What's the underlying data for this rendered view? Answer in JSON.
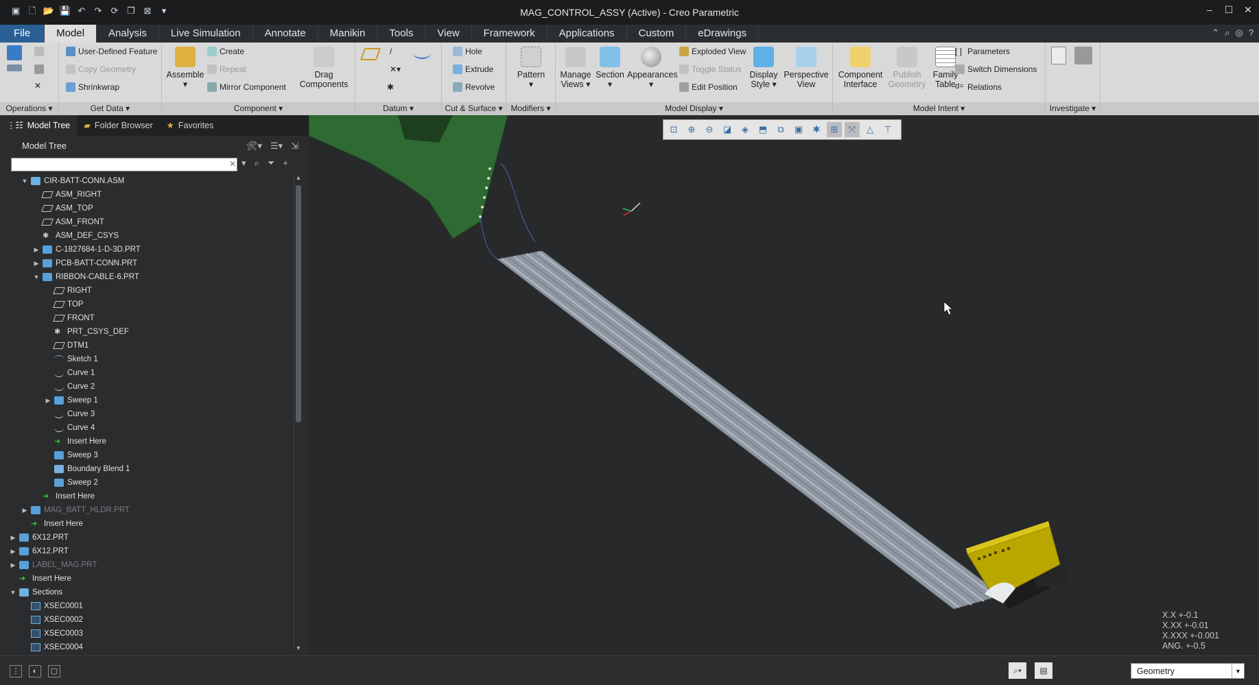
{
  "window": {
    "title": "MAG_CONTROL_ASSY (Active) - Creo Parametric"
  },
  "tabs": [
    "File",
    "Model",
    "Analysis",
    "Live Simulation",
    "Annotate",
    "Manikin",
    "Tools",
    "View",
    "Framework",
    "Applications",
    "Custom",
    "eDrawings"
  ],
  "ribbon": {
    "get_data": {
      "udf": "User-Defined Feature",
      "copy_geometry": "Copy Geometry",
      "shrinkwrap": "Shrinkwrap",
      "label": "Get Data"
    },
    "operations": {
      "label": "Operations"
    },
    "component": {
      "assemble": "Assemble",
      "create": "Create",
      "repeat": "Repeat",
      "mirror": "Mirror Component",
      "drag": "Drag Components",
      "label": "Component"
    },
    "datum": {
      "label": "Datum"
    },
    "cut_surface": {
      "hole": "Hole",
      "extrude": "Extrude",
      "revolve": "Revolve",
      "label": "Cut & Surface"
    },
    "modifiers": {
      "pattern": "Pattern",
      "label": "Modifiers"
    },
    "model_display": {
      "manage_views": "Manage Views",
      "section": "Section",
      "appearances": "Appearances",
      "exploded_view": "Exploded View",
      "toggle_status": "Toggle Status",
      "edit_position": "Edit Position",
      "display_style": "Display Style",
      "perspective_view": "Perspective View",
      "label": "Model Display"
    },
    "model_intent": {
      "component_interface": "Component Interface",
      "publish_geometry": "Publish Geometry",
      "family_table": "Family Table",
      "parameters": "Parameters",
      "switch_dimensions": "Switch Dimensions",
      "relations": "Relations",
      "label": "Model Intent"
    },
    "investigate": {
      "label": "Investigate"
    }
  },
  "panel": {
    "tabs": [
      "Model Tree",
      "Folder Browser",
      "Favorites"
    ],
    "tree_title": "Model Tree",
    "search_value": "",
    "tree": [
      {
        "depth": 1,
        "twisty": "open",
        "icon": "assembly",
        "label": "CIR-BATT-CONN.ASM",
        "dim": false
      },
      {
        "depth": 2,
        "twisty": "",
        "icon": "datum-plane",
        "label": "ASM_RIGHT",
        "dim": false
      },
      {
        "depth": 2,
        "twisty": "",
        "icon": "datum-plane",
        "label": "ASM_TOP",
        "dim": false
      },
      {
        "depth": 2,
        "twisty": "",
        "icon": "datum-plane",
        "label": "ASM_FRONT",
        "dim": false
      },
      {
        "depth": 2,
        "twisty": "",
        "icon": "csys",
        "label": "ASM_DEF_CSYS",
        "dim": false
      },
      {
        "depth": 2,
        "twisty": "closed",
        "icon": "part",
        "label": "C-1827684-1-D-3D.PRT",
        "dim": false
      },
      {
        "depth": 2,
        "twisty": "closed",
        "icon": "part",
        "label": "PCB-BATT-CONN.PRT",
        "dim": false
      },
      {
        "depth": 2,
        "twisty": "open",
        "icon": "part",
        "label": "RIBBON-CABLE-6.PRT",
        "dim": false
      },
      {
        "depth": 3,
        "twisty": "",
        "icon": "datum-plane",
        "label": "RIGHT",
        "dim": false
      },
      {
        "depth": 3,
        "twisty": "",
        "icon": "datum-plane",
        "label": "TOP",
        "dim": false
      },
      {
        "depth": 3,
        "twisty": "",
        "icon": "datum-plane",
        "label": "FRONT",
        "dim": false
      },
      {
        "depth": 3,
        "twisty": "",
        "icon": "csys",
        "label": "PRT_CSYS_DEF",
        "dim": false
      },
      {
        "depth": 3,
        "twisty": "",
        "icon": "datum-plane",
        "label": "DTM1",
        "dim": false
      },
      {
        "depth": 3,
        "twisty": "",
        "icon": "sketch",
        "label": "Sketch 1",
        "dim": false
      },
      {
        "depth": 3,
        "twisty": "",
        "icon": "curve",
        "label": "Curve 1",
        "dim": false
      },
      {
        "depth": 3,
        "twisty": "",
        "icon": "curve",
        "label": "Curve 2",
        "dim": false
      },
      {
        "depth": 3,
        "twisty": "closed",
        "icon": "sweep",
        "label": "Sweep 1",
        "dim": false
      },
      {
        "depth": 3,
        "twisty": "",
        "icon": "curve",
        "label": "Curve 3",
        "dim": false
      },
      {
        "depth": 3,
        "twisty": "",
        "icon": "curve",
        "label": "Curve 4",
        "dim": false
      },
      {
        "depth": 3,
        "twisty": "",
        "icon": "insert-arrow",
        "label": "Insert Here",
        "dim": false
      },
      {
        "depth": 3,
        "twisty": "",
        "icon": "sweep",
        "label": "Sweep 3",
        "dim": false
      },
      {
        "depth": 3,
        "twisty": "",
        "icon": "blend",
        "label": "Boundary Blend 1",
        "dim": false
      },
      {
        "depth": 3,
        "twisty": "",
        "icon": "sweep",
        "label": "Sweep 2",
        "dim": false
      },
      {
        "depth": 2,
        "twisty": "",
        "icon": "insert-arrow",
        "label": "Insert Here",
        "dim": false
      },
      {
        "depth": 1,
        "twisty": "closed",
        "icon": "part",
        "label": "MAG_BATT_HLDR.PRT",
        "dim": true
      },
      {
        "depth": 1,
        "twisty": "",
        "icon": "insert-arrow",
        "label": "Insert Here",
        "dim": false
      },
      {
        "depth": 0,
        "twisty": "closed",
        "icon": "part",
        "label": "6X12.PRT",
        "dim": false
      },
      {
        "depth": 0,
        "twisty": "closed",
        "icon": "part",
        "label": "6X12.PRT",
        "dim": false
      },
      {
        "depth": 0,
        "twisty": "closed",
        "icon": "part",
        "label": "LABEL_MAG.PRT",
        "dim": true
      },
      {
        "depth": 0,
        "twisty": "",
        "icon": "insert-arrow",
        "label": "Insert Here",
        "dim": false
      },
      {
        "depth": 0,
        "twisty": "open",
        "icon": "assembly",
        "label": "Sections",
        "dim": false
      },
      {
        "depth": 1,
        "twisty": "",
        "icon": "section",
        "label": "XSEC0001",
        "dim": false
      },
      {
        "depth": 1,
        "twisty": "",
        "icon": "section",
        "label": "XSEC0002",
        "dim": false
      },
      {
        "depth": 1,
        "twisty": "",
        "icon": "section",
        "label": "XSEC0003",
        "dim": false
      },
      {
        "depth": 1,
        "twisty": "",
        "icon": "section",
        "label": "XSEC0004",
        "dim": false
      }
    ]
  },
  "viewport": {
    "tolerances": [
      "X.X +-0.1",
      "X.XX +-0.01",
      "X.XXX +-0.001",
      "ANG. +-0.5"
    ]
  },
  "status": {
    "filter": "Geometry"
  },
  "colors": {
    "accent": "#2a5f95",
    "pcb": "#2e6a32",
    "cable": "#8c96a0",
    "connector": "#b9a700"
  }
}
